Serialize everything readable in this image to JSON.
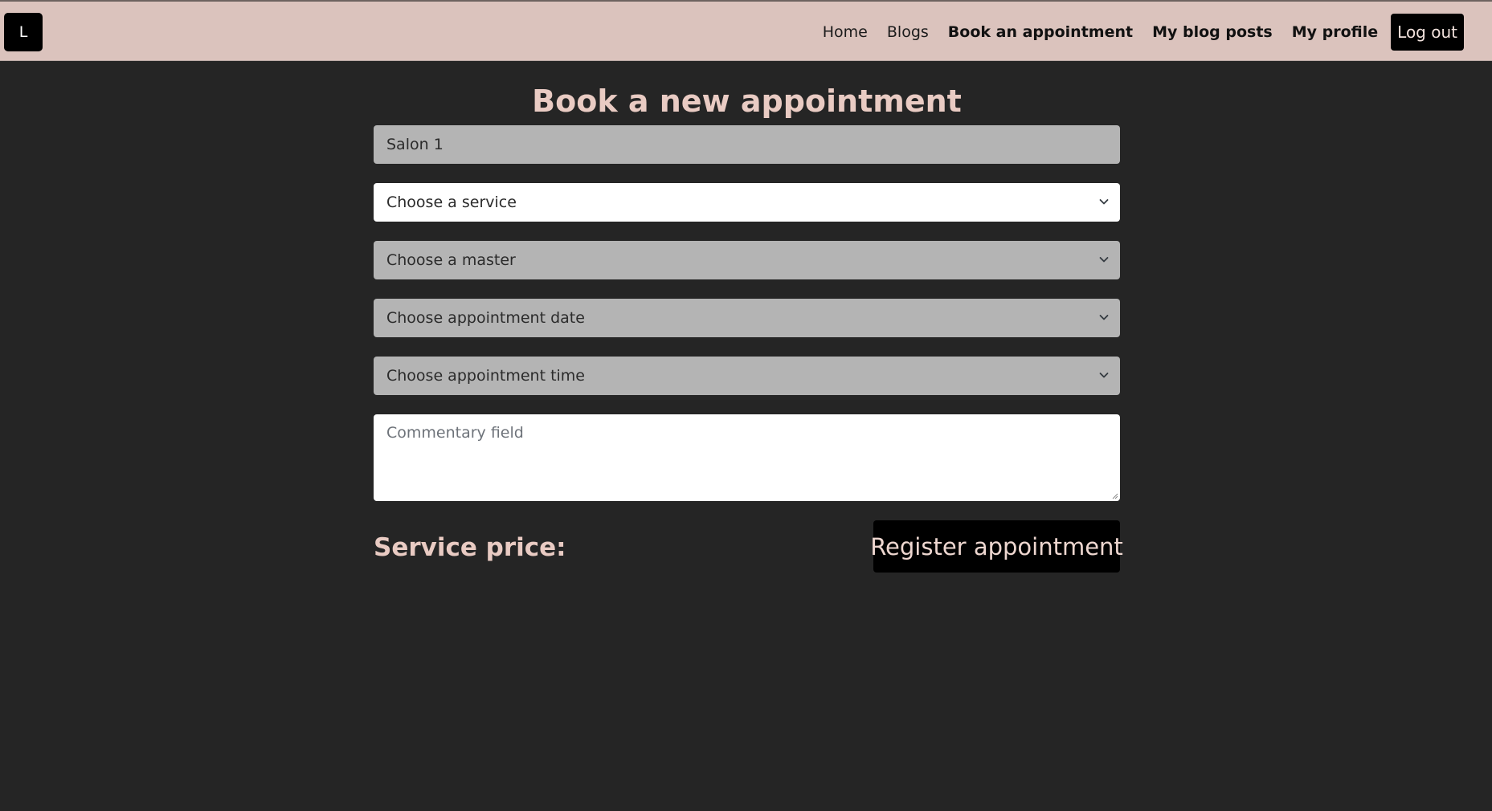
{
  "navbar": {
    "logo_text": "L",
    "links": [
      {
        "label": "Home"
      },
      {
        "label": "Blogs"
      },
      {
        "label": "Book an appointment"
      },
      {
        "label": "My blog posts"
      },
      {
        "label": "My profile"
      }
    ],
    "logout_label": "Log out"
  },
  "form": {
    "title": "Book a new appointment",
    "salon_value": "Salon 1",
    "service_select": "Choose a service",
    "master_select": "Choose a master",
    "date_select": "Choose appointment date",
    "time_select": "Choose appointment time",
    "commentary_placeholder": "Commentary field",
    "price_label": "Service price:",
    "register_label": "Register appointment"
  },
  "icons": {
    "select_arrow": "chevron-down-icon",
    "textarea_resize": "resize-grip-icon"
  },
  "colors": {
    "navbar_bg": "#dbc3bd",
    "page_bg": "#252525",
    "accent_text": "#e9cbc3",
    "button_bg": "#000000",
    "disabled_field": "#b4b4b4"
  }
}
